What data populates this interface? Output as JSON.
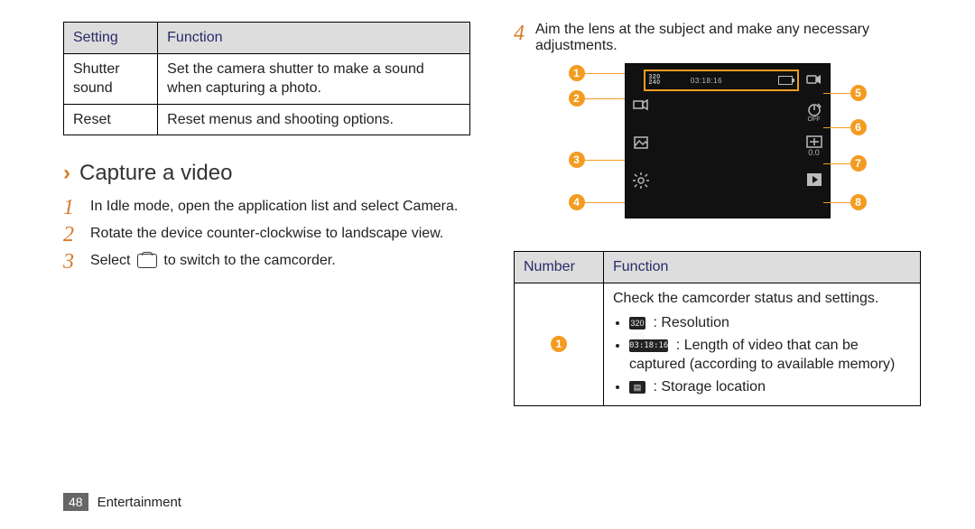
{
  "settings_table": {
    "headers": {
      "setting": "Setting",
      "function": "Function"
    },
    "rows": [
      {
        "setting": "Shutter sound",
        "function": "Set the camera shutter to make a sound when capturing a photo."
      },
      {
        "setting": "Reset",
        "function": "Reset menus and shooting options."
      }
    ]
  },
  "section_title": "Capture a video",
  "steps": {
    "s1": "In Idle mode, open the application list and select Camera.",
    "s2": "Rotate the device counter-clockwise to landscape view.",
    "s3_before": "Select",
    "s3_after": " to switch to the camcorder.",
    "s4": "Aim the lens at the subject and make any necessary adjustments."
  },
  "screen": {
    "resolution_label": "320\n240",
    "time": "03:18:16",
    "ev_label": "0.0",
    "timer_label": "OFF"
  },
  "callouts": [
    "1",
    "2",
    "3",
    "4",
    "5",
    "6",
    "7",
    "8"
  ],
  "func_table": {
    "headers": {
      "number": "Number",
      "function": "Function"
    },
    "row1": {
      "intro": "Check the camcorder status and settings.",
      "b1": " : Resolution",
      "b2": " : Length of video that can be captured (according to available memory)",
      "b3": " : Storage location",
      "b2_prefix": "03:18:16"
    }
  },
  "footer": {
    "page": "48",
    "section": "Entertainment"
  }
}
